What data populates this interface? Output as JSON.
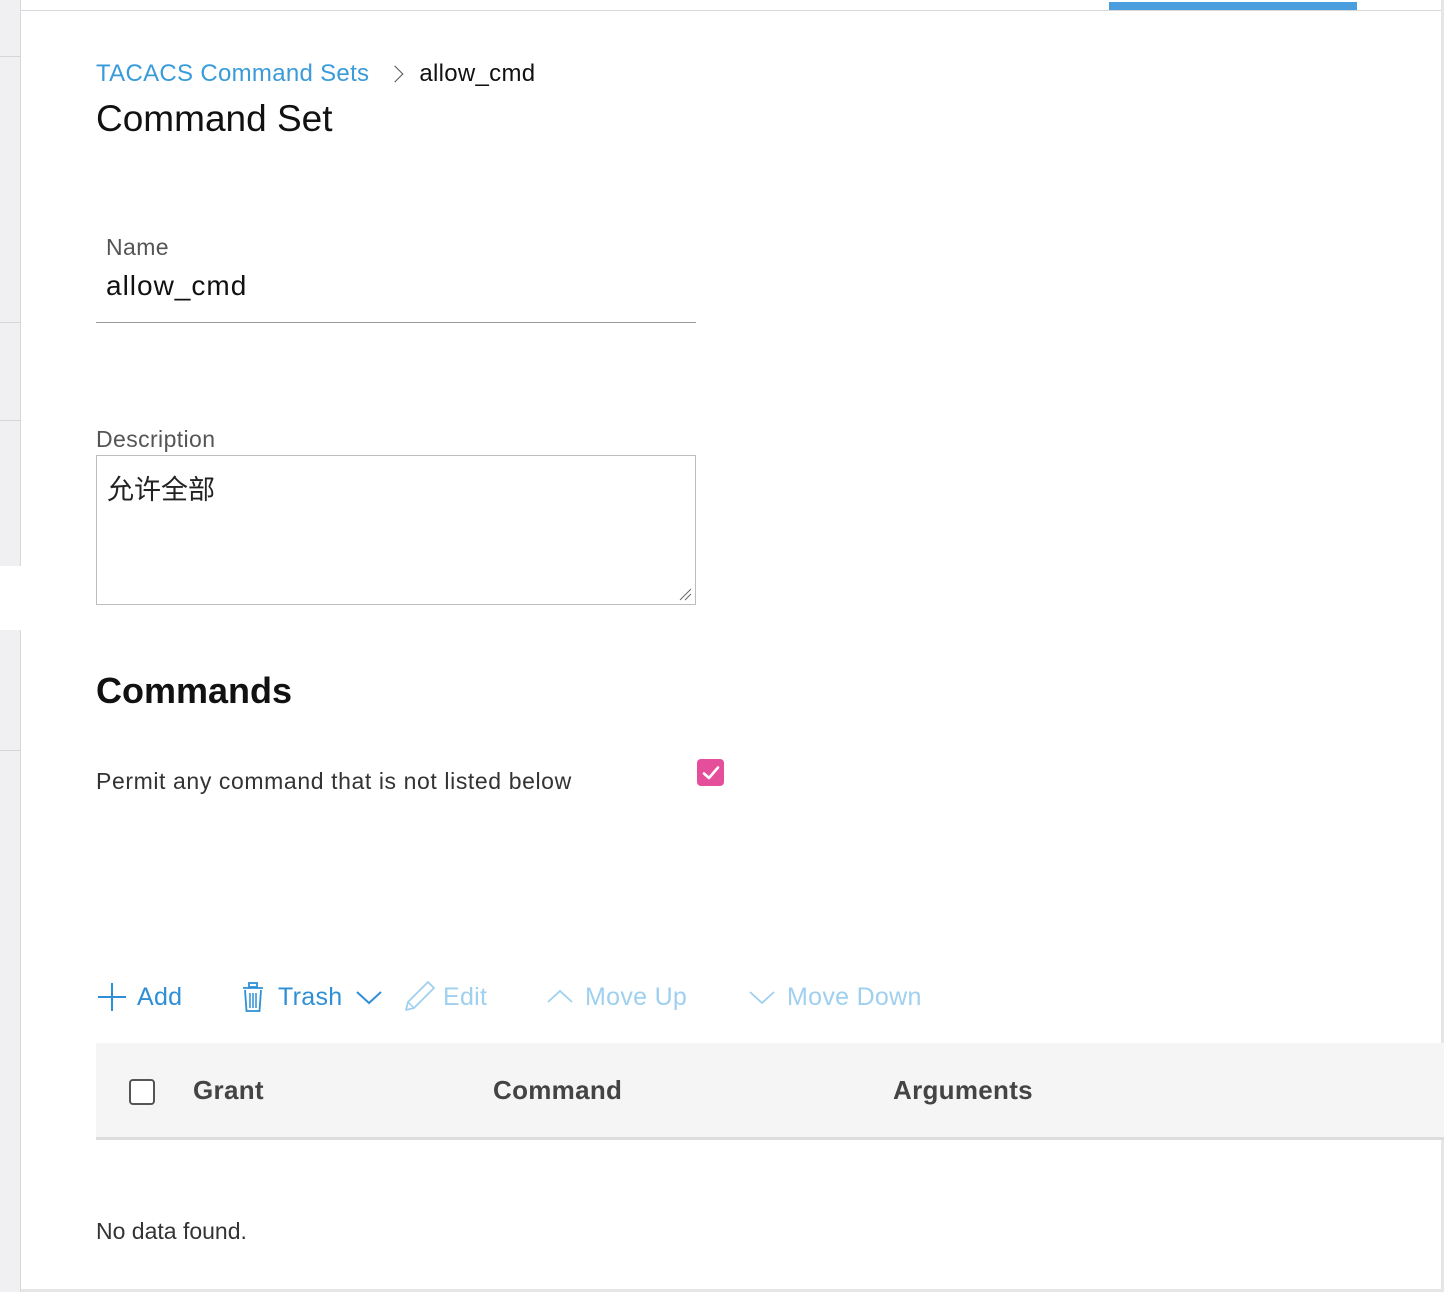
{
  "breadcrumb": {
    "parent_label": "TACACS Command Sets",
    "current_label": "allow_cmd"
  },
  "page": {
    "title": "Command Set"
  },
  "form": {
    "name_label": "Name",
    "name_value": "allow_cmd",
    "description_label": "Description",
    "description_value": "允许全部"
  },
  "commands": {
    "section_title": "Commands",
    "permit_label": "Permit any command that is not listed below",
    "permit_checked": true,
    "accent_color": "#e54e9b"
  },
  "toolbar": {
    "add_label": "Add",
    "trash_label": "Trash",
    "edit_label": "Edit",
    "move_up_label": "Move Up",
    "move_down_label": "Move Down"
  },
  "table": {
    "columns": [
      "Grant",
      "Command",
      "Arguments"
    ],
    "rows": [],
    "empty_message": "No data found."
  },
  "icons": {
    "add": "plus-icon",
    "trash": "trash-icon",
    "dropdown": "chevron-down-icon",
    "edit": "pencil-icon",
    "move_up": "chevron-up-icon",
    "move_down": "chevron-down-icon",
    "breadcrumb_sep": "chevron-right-icon",
    "checkbox": "check-icon"
  },
  "colors": {
    "link": "#3a9bd9",
    "active_tab": "#4a9ede",
    "toolbar_active": "#2e8fd6",
    "toolbar_disabled": "#9fd0ef"
  }
}
